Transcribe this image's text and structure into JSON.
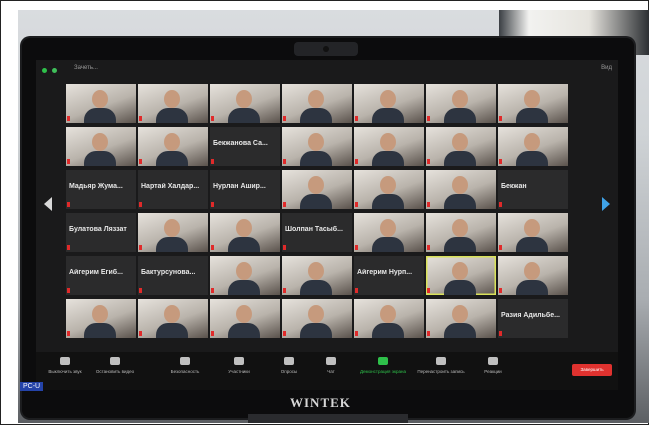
{
  "monitor": {
    "brand": "WINTEK",
    "badge": "PC-U",
    "colors": {
      "bezel": "#0c0c0d",
      "active_speaker": "#d9e25a",
      "end_button": "#e0322f",
      "share_button": "#2ec04a",
      "next_page_arrow": "#3fa3e8"
    }
  },
  "zoom": {
    "window_title": "Зачеть...",
    "view_label": "Вид",
    "tiles": [
      {
        "type": "video",
        "label": ""
      },
      {
        "type": "video",
        "label": ""
      },
      {
        "type": "video",
        "label": ""
      },
      {
        "type": "video",
        "label": ""
      },
      {
        "type": "video",
        "label": ""
      },
      {
        "type": "video",
        "label": ""
      },
      {
        "type": "video",
        "label": ""
      },
      {
        "type": "video",
        "label": ""
      },
      {
        "type": "video",
        "label": ""
      },
      {
        "type": "name",
        "label": "Бекжанова Са..."
      },
      {
        "type": "video",
        "label": ""
      },
      {
        "type": "video",
        "label": ""
      },
      {
        "type": "video",
        "label": ""
      },
      {
        "type": "video",
        "label": ""
      },
      {
        "type": "name",
        "label": "Мадьяр Жума..."
      },
      {
        "type": "name",
        "label": "Нартай Халдар..."
      },
      {
        "type": "name",
        "label": "Нурлан Ашир..."
      },
      {
        "type": "video",
        "label": ""
      },
      {
        "type": "video",
        "label": ""
      },
      {
        "type": "video",
        "label": ""
      },
      {
        "type": "name",
        "label": "Бекжан"
      },
      {
        "type": "name",
        "label": "Булатова Ляззат"
      },
      {
        "type": "video",
        "label": ""
      },
      {
        "type": "video",
        "label": ""
      },
      {
        "type": "name",
        "label": "Шолпан Тасыб..."
      },
      {
        "type": "video",
        "label": ""
      },
      {
        "type": "video",
        "label": ""
      },
      {
        "type": "video",
        "label": ""
      },
      {
        "type": "name",
        "label": "Айгерим Егиб..."
      },
      {
        "type": "name",
        "label": "Бактурсунова..."
      },
      {
        "type": "video",
        "label": ""
      },
      {
        "type": "video",
        "label": ""
      },
      {
        "type": "name",
        "label": "Айгерим Нурп..."
      },
      {
        "type": "video",
        "label": ""
      },
      {
        "type": "video",
        "label": ""
      },
      {
        "type": "video",
        "label": ""
      },
      {
        "type": "video",
        "label": ""
      },
      {
        "type": "video",
        "label": ""
      },
      {
        "type": "video",
        "label": ""
      },
      {
        "type": "video",
        "label": ""
      },
      {
        "type": "video",
        "label": ""
      },
      {
        "type": "name",
        "label": "Разия Адильбе..."
      }
    ],
    "toolbar": [
      {
        "icon": "microphone-icon",
        "label": "Выключить звук"
      },
      {
        "icon": "video-camera-icon",
        "label": "Остановить видео"
      },
      {
        "icon": "shield-icon",
        "label": "Безопасность"
      },
      {
        "icon": "participants-icon",
        "label": "Участники"
      },
      {
        "icon": "poll-icon",
        "label": "Опросы"
      },
      {
        "icon": "chat-icon",
        "label": "Чат"
      },
      {
        "icon": "share-screen-icon",
        "label": "Демонстрация экрана"
      },
      {
        "icon": "record-icon",
        "label": "Перенастроить запись"
      },
      {
        "icon": "reactions-icon",
        "label": "Реакции"
      }
    ],
    "end_label": "Завершить"
  }
}
